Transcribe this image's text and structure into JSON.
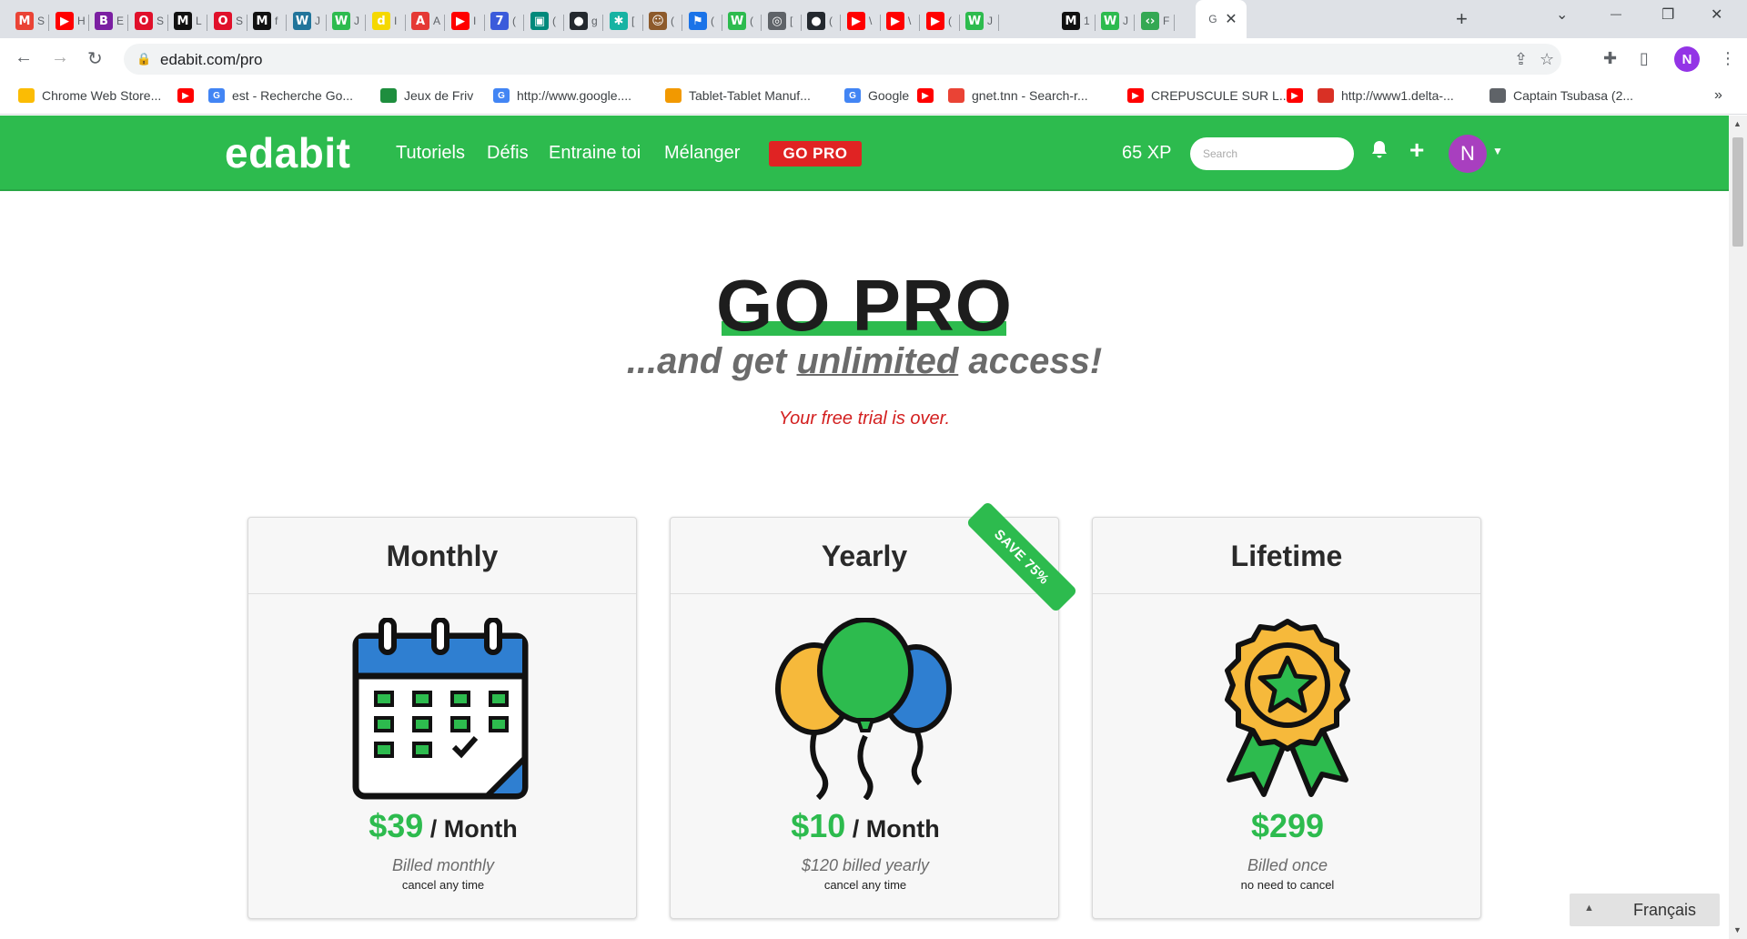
{
  "browser": {
    "tabs": [
      {
        "icon": "gmail-icon",
        "letter": "M",
        "color": "#ea4335",
        "text": "S"
      },
      {
        "icon": "youtube-icon",
        "letter": "▶",
        "color": "#ff0000",
        "text": "H"
      },
      {
        "icon": "b-icon",
        "letter": "B",
        "color": "#7b1fa2",
        "text": "E"
      },
      {
        "icon": "opera-icon",
        "letter": "O",
        "color": "#e0102a",
        "text": "S"
      },
      {
        "icon": "m-icon",
        "letter": "M",
        "color": "#111111",
        "text": "L"
      },
      {
        "icon": "opera-icon",
        "letter": "O",
        "color": "#e0102a",
        "text": "S"
      },
      {
        "icon": "m-icon",
        "letter": "M",
        "color": "#111111",
        "text": "f"
      },
      {
        "icon": "wordpress-icon",
        "letter": "W",
        "color": "#21759b",
        "text": "J"
      },
      {
        "icon": "edabit-icon",
        "letter": "W",
        "color": "#2dbb4e",
        "text": "J"
      },
      {
        "icon": "d-icon",
        "letter": "d",
        "color": "#f5d800",
        "text": "I"
      },
      {
        "icon": "tower-icon",
        "letter": "A",
        "color": "#e53935",
        "text": "A"
      },
      {
        "icon": "youtube-icon",
        "letter": "▶",
        "color": "#ff0000",
        "text": "I"
      },
      {
        "icon": "seven-icon",
        "letter": "7",
        "color": "#3b5bdb",
        "text": "("
      },
      {
        "icon": "meet-icon",
        "letter": "▣",
        "color": "#00897b",
        "text": "("
      },
      {
        "icon": "github-icon",
        "letter": "●",
        "color": "#24292f",
        "text": "g"
      },
      {
        "icon": "star-icon",
        "letter": "✱",
        "color": "#17b3a3",
        "text": "["
      },
      {
        "icon": "avatar-icon",
        "letter": "☺",
        "color": "#8d5a2b",
        "text": "("
      },
      {
        "icon": "flag-icon",
        "letter": "⚑",
        "color": "#1a73e8",
        "text": "("
      },
      {
        "icon": "edabit-icon",
        "letter": "W",
        "color": "#2dbb4e",
        "text": "("
      },
      {
        "icon": "globe-icon",
        "letter": "◎",
        "color": "#5f6368",
        "text": "["
      },
      {
        "icon": "github-icon",
        "letter": "●",
        "color": "#24292f",
        "text": "("
      },
      {
        "icon": "youtube-icon",
        "letter": "▶",
        "color": "#ff0000",
        "text": "\\"
      },
      {
        "icon": "youtube-icon",
        "letter": "▶",
        "color": "#ff0000",
        "text": "\\"
      },
      {
        "icon": "youtube-icon",
        "letter": "▶",
        "color": "#ff0000",
        "text": "("
      },
      {
        "icon": "edabit-icon",
        "letter": "W",
        "color": "#2dbb4e",
        "text": "J"
      },
      {
        "icon": "m-icon",
        "letter": "M",
        "color": "#111111",
        "text": "1"
      },
      {
        "icon": "edabit-icon",
        "letter": "W",
        "color": "#2dbb4e",
        "text": "J"
      },
      {
        "icon": "code-icon",
        "letter": "‹›",
        "color": "#34a853",
        "text": "F"
      }
    ],
    "active_tab": {
      "text": "G",
      "close": "✕"
    },
    "new_tab": "+",
    "window_controls": {
      "chevron": "⌄",
      "minimize": "—",
      "restore": "❐",
      "close": "✕"
    },
    "url": "edabit.com/pro",
    "profile_letter": "N",
    "bookmarks": [
      {
        "icon": "chrome-webstore-icon",
        "color": "#fbbc04",
        "label": "Chrome Web Store..."
      },
      {
        "icon": "youtube-icon",
        "color": "#ff0000",
        "label": ""
      },
      {
        "icon": "google-icon",
        "color": "#4285f4",
        "label": "est - Recherche Go..."
      },
      {
        "icon": "friv-icon",
        "color": "#1e8e3e",
        "label": "Jeux de Friv"
      },
      {
        "icon": "google-icon",
        "color": "#4285f4",
        "label": "http://www.google...."
      },
      {
        "icon": "tablet-icon",
        "color": "#f29900",
        "label": "Tablet-Tablet Manuf..."
      },
      {
        "icon": "google-icon",
        "color": "#4285f4",
        "label": "Google"
      },
      {
        "icon": "youtube-icon",
        "color": "#ff0000",
        "label": ""
      },
      {
        "icon": "gnet-icon",
        "color": "#ea4335",
        "label": "gnet.tnn - Search-r..."
      },
      {
        "icon": "youtube-icon",
        "color": "#ff0000",
        "label": "CREPUSCULE SUR L..."
      },
      {
        "icon": "youtube-icon",
        "color": "#ff0000",
        "label": ""
      },
      {
        "icon": "delta-icon",
        "color": "#d93025",
        "label": "http://www1.delta-..."
      },
      {
        "icon": "tsubasa-icon",
        "color": "#5f6368",
        "label": "Captain Tsubasa (2..."
      }
    ],
    "bookmarks_more": "»"
  },
  "site": {
    "brand": "edabit",
    "nav": [
      "Tutoriels",
      "Défis",
      "Entraine toi",
      "Mélanger"
    ],
    "gopro_button": "GO PRO",
    "xp": "65 XP",
    "search_placeholder": "Search",
    "avatar_letter": "N"
  },
  "hero": {
    "title": "GO PRO",
    "subtitle_before": "...and get ",
    "subtitle_underlined": "unlimited",
    "subtitle_after": " access!",
    "trial_message": "Your free trial is over."
  },
  "plans": [
    {
      "name": "Monthly",
      "price": "$39",
      "period": " / Month",
      "billing": "Billed monthly",
      "note": "cancel any time",
      "icon": "calendar-icon"
    },
    {
      "name": "Yearly",
      "price": "$10",
      "period": " / Month",
      "billing": "$120 billed yearly",
      "note": "cancel any time",
      "icon": "balloons-icon",
      "ribbon": "SAVE 75%"
    },
    {
      "name": "Lifetime",
      "price": "$299",
      "period": "",
      "billing": "Billed once",
      "note": "no need to cancel",
      "icon": "award-badge-icon"
    }
  ],
  "language_selector": {
    "label": "Français",
    "arrow": "▲"
  },
  "colors": {
    "brand_green": "#2dbb4e",
    "gopro_red": "#e02323",
    "trial_red": "#d32020",
    "calendar_blue": "#2f7fd1",
    "balloon_yellow": "#f6b93b",
    "balloon_blue": "#2f7fd1"
  }
}
